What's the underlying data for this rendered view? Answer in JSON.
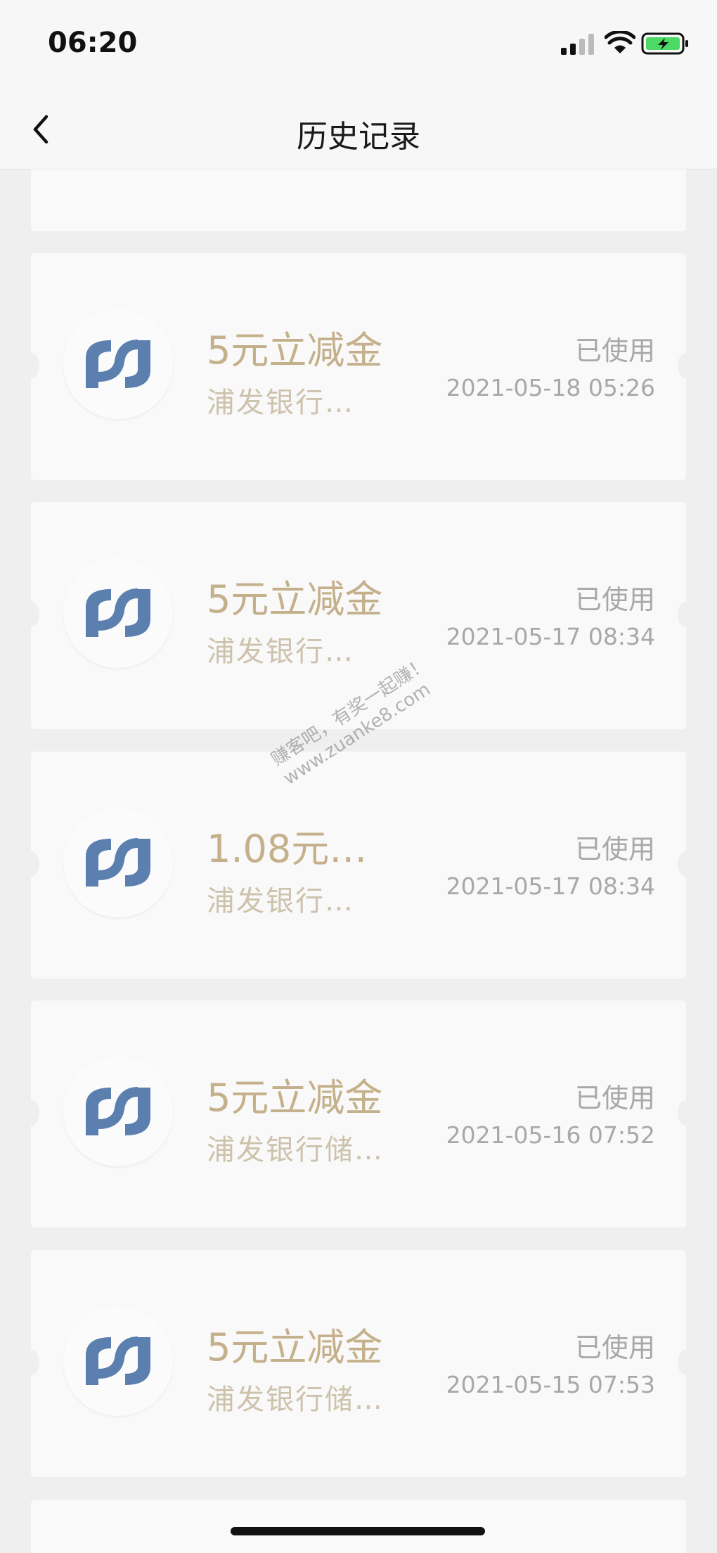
{
  "status_bar": {
    "time": "06:20"
  },
  "nav": {
    "title": "历史记录"
  },
  "coupons": [
    {
      "title": "5元立减金",
      "subtitle": "浦发银行…",
      "status": "已使用",
      "date": "2021-05-18 05:26"
    },
    {
      "title": "5元立减金",
      "subtitle": "浦发银行…",
      "status": "已使用",
      "date": "2021-05-17 08:34"
    },
    {
      "title": "1.08元…",
      "subtitle": "浦发银行…",
      "status": "已使用",
      "date": "2021-05-17 08:34"
    },
    {
      "title": "5元立减金",
      "subtitle": "浦发银行储…",
      "status": "已使用",
      "date": "2021-05-16 07:52"
    },
    {
      "title": "5元立减金",
      "subtitle": "浦发银行储…",
      "status": "已使用",
      "date": "2021-05-15 07:53"
    }
  ],
  "watermark": {
    "line1": "赚客吧，有奖一起赚！",
    "line2": "www.zuanke8.com"
  },
  "colors": {
    "accent_gold": "#c4b08a",
    "logo_blue": "#5b7fae",
    "muted_gray": "#a8a8a8"
  },
  "icons": {
    "back": "chevron-left-icon",
    "logo": "spdb-logo-icon"
  }
}
